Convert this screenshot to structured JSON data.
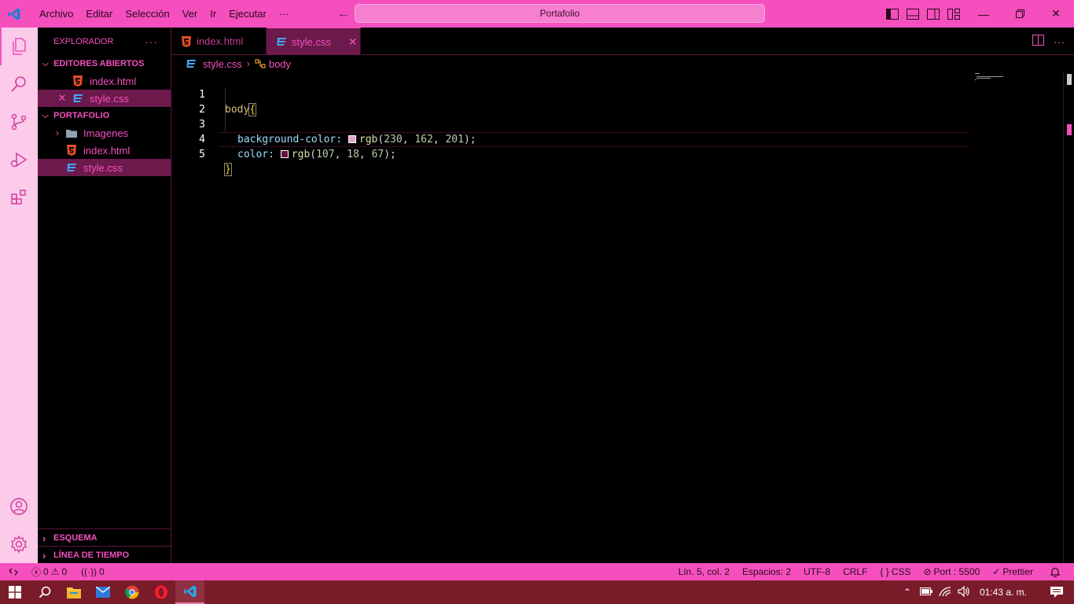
{
  "titlebar": {
    "menu": [
      "Archivo",
      "Editar",
      "Selección",
      "Ver",
      "Ir",
      "Ejecutar",
      "···"
    ],
    "command_center": "Portafolio"
  },
  "sidebar": {
    "header": "EXPLORADOR",
    "open_editors_title": "EDITORES ABIERTOS",
    "open_editors": [
      {
        "name": "index.html",
        "type": "html"
      },
      {
        "name": "style.css",
        "type": "css"
      }
    ],
    "folder_title": "PORTAFOLIO",
    "tree": [
      {
        "name": "Imagenes",
        "type": "folder"
      },
      {
        "name": "index.html",
        "type": "html"
      },
      {
        "name": "style.css",
        "type": "css"
      }
    ],
    "outline_title": "ESQUEMA",
    "timeline_title": "LÍNEA DE TIEMPO"
  },
  "tabs": [
    {
      "label": "index.html",
      "type": "html",
      "active": false
    },
    {
      "label": "style.css",
      "type": "css",
      "active": true
    }
  ],
  "breadcrumb": {
    "file": "style.css",
    "symbol": "body"
  },
  "editor": {
    "line_numbers": [
      "1",
      "2",
      "3",
      "4",
      "5"
    ],
    "selector": "body",
    "open_brace": "{",
    "close_brace": "}",
    "prop1": "background-color:",
    "prop1_fn": "rgb",
    "prop1_args": [
      "230",
      "162",
      "201"
    ],
    "prop1_swatch": "#e6a2c9",
    "prop2": "color:",
    "prop2_fn": "rgb",
    "prop2_args": [
      "107",
      "18",
      "67"
    ],
    "prop2_swatch": "#6b1243"
  },
  "status": {
    "errors": "0",
    "warnings": "0",
    "ports": "0",
    "position": "Lín. 5, col. 2",
    "spaces": "Espacios: 2",
    "encoding": "UTF-8",
    "eol": "CRLF",
    "language": "CSS",
    "port": "Port : 5500",
    "prettier": "Prettier"
  },
  "taskbar": {
    "clock": "01:43 a. m."
  },
  "colors": {
    "accent": "#f54fbe",
    "activity_bar": "#fccbea",
    "selection": "#6b1a4b"
  }
}
